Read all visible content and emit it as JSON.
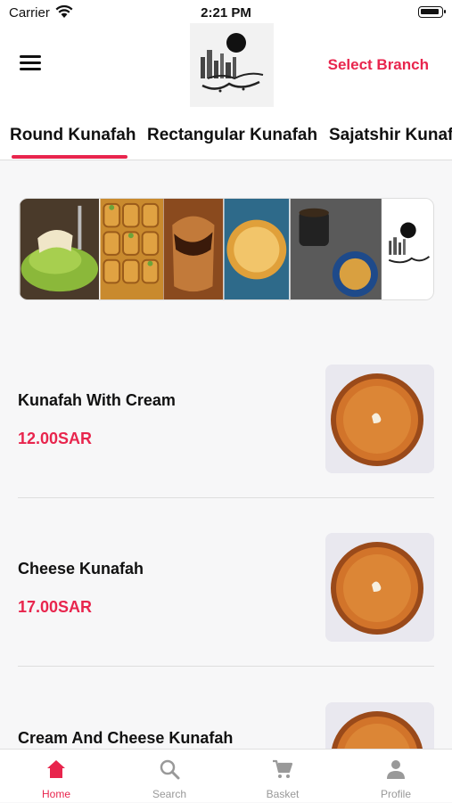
{
  "status_bar": {
    "carrier": "Carrier",
    "time": "2:21 PM"
  },
  "header": {
    "select_branch": "Select Branch",
    "logo_text": "كنافة كنتري"
  },
  "tabs": [
    {
      "label": "Round Kunafah",
      "active": true
    },
    {
      "label": "Rectangular Kunafah",
      "active": false
    },
    {
      "label": "Sajatshir Kunafah",
      "active": false
    }
  ],
  "products": [
    {
      "name": "Kunafah With Cream",
      "price": "12.00SAR"
    },
    {
      "name": "Cheese Kunafah",
      "price": "17.00SAR"
    },
    {
      "name": "Cream And Cheese Kunafah",
      "price": ""
    }
  ],
  "bottom_nav": [
    {
      "label": "Home",
      "icon": "home-icon",
      "active": true
    },
    {
      "label": "Search",
      "icon": "search-icon",
      "active": false
    },
    {
      "label": "Basket",
      "icon": "basket-icon",
      "active": false
    },
    {
      "label": "Profile",
      "icon": "profile-icon",
      "active": false
    }
  ],
  "colors": {
    "accent": "#e8254d",
    "inactive": "#999999"
  }
}
